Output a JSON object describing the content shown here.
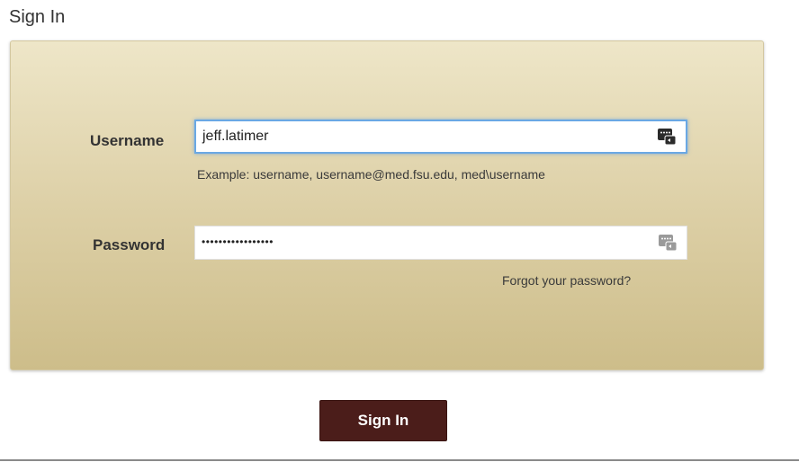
{
  "page": {
    "title": "Sign In"
  },
  "form": {
    "username": {
      "label": "Username",
      "value": "jeff.latimer",
      "hint": "Example: username, username@med.fsu.edu, med\\username",
      "icon": "password-manager-icon"
    },
    "password": {
      "label": "Password",
      "masked_value": "•••••••••••••••••",
      "icon": "password-manager-icon"
    },
    "forgot_link": "Forgot your password?"
  },
  "actions": {
    "submit_label": "Sign In"
  },
  "colors": {
    "panel_top": "#eee6c8",
    "panel_bottom": "#cdbd8a",
    "button_bg": "#4b1d1a",
    "focus_ring": "#6aa8e4"
  }
}
